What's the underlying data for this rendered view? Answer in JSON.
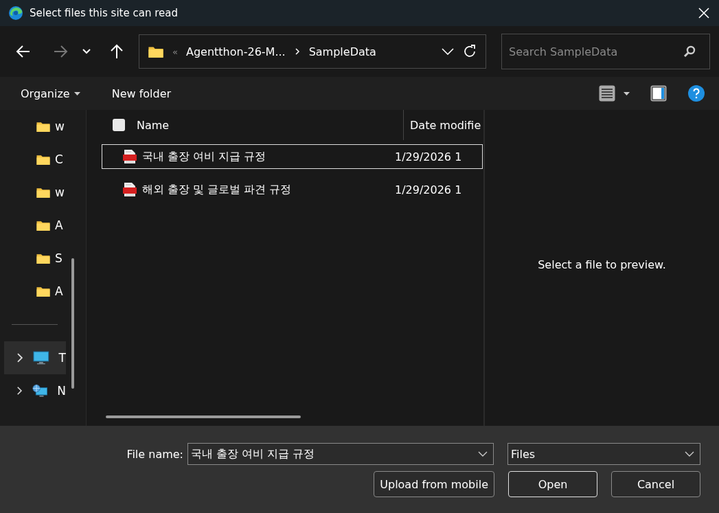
{
  "window": {
    "title": "Select files this site can read"
  },
  "address": {
    "overflow": "«",
    "crumbs": [
      "Agentthon-26-M...",
      "SampleData"
    ]
  },
  "search": {
    "placeholder": "Search SampleData"
  },
  "toolbar": {
    "organize": "Organize",
    "new_folder": "New folder"
  },
  "sidebar": {
    "items": [
      {
        "kind": "folder",
        "label": "w",
        "selected": false
      },
      {
        "kind": "folder",
        "label": "C",
        "selected": false
      },
      {
        "kind": "folder",
        "label": "w",
        "selected": false
      },
      {
        "kind": "folder",
        "label": "A",
        "selected": false
      },
      {
        "kind": "folder",
        "label": "S",
        "selected": false
      },
      {
        "kind": "folder",
        "label": "A",
        "selected": false
      },
      {
        "kind": "separator"
      },
      {
        "kind": "pc",
        "label": "T",
        "selected": true,
        "expanded": false
      },
      {
        "kind": "network",
        "label": "N",
        "selected": false,
        "expanded": false
      }
    ]
  },
  "table": {
    "select_all_checked": false,
    "columns": [
      "Name",
      "Date modifie"
    ],
    "rows": [
      {
        "name": "국내 출장 여비 지급 규정",
        "date": "1/29/2026 1",
        "selected": true
      },
      {
        "name": "해외 출장 및 글로벌 파견 규정",
        "date": "1/29/2026 1",
        "selected": false
      }
    ]
  },
  "preview": {
    "message": "Select a file to preview."
  },
  "footer": {
    "file_name_label": "File name:",
    "file_name": "국내 출장 여비 지급 규정",
    "filter": "Files",
    "buttons": [
      {
        "label": "Upload from mobile",
        "kind": "normal"
      },
      {
        "label": "Open",
        "kind": "default"
      },
      {
        "label": "Cancel",
        "kind": "normal"
      }
    ]
  }
}
